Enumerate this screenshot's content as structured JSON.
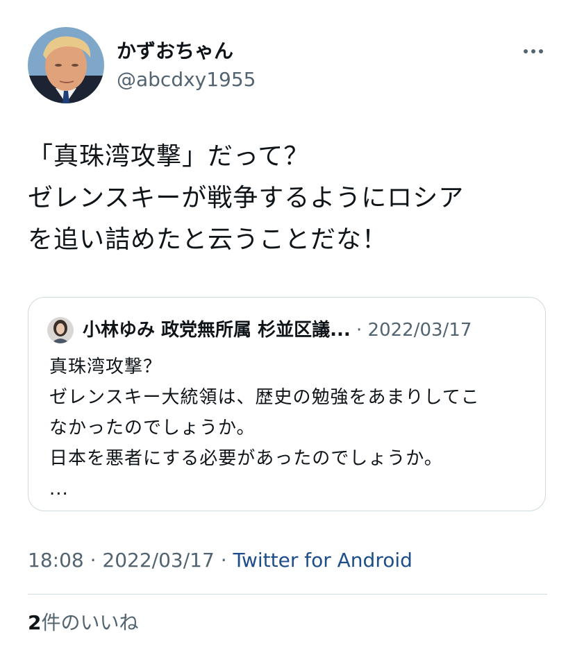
{
  "author": {
    "display_name": "かずおちゃん",
    "handle": "@abcdxy1955"
  },
  "tweet": {
    "lines": [
      "「真珠湾攻撃」だって？",
      "ゼレンスキーが戦争するようにロシア",
      "を追い詰めたと云うことだな！"
    ]
  },
  "quote": {
    "author_name": "小林ゆみ 政党無所属 杉並区議...",
    "separator": "·",
    "date": "2022/03/17",
    "lines": [
      "真珠湾攻撃？",
      "ゼレンスキー大統領は、歴史の勉強をあまりしてこ",
      "なかったのでしょうか。",
      "日本を悪者にする必要があったのでしょうか。",
      "..."
    ]
  },
  "meta": {
    "time": "18:08",
    "sep1": " · ",
    "date": "2022/03/17",
    "sep2": " · ",
    "source": "Twitter for Android"
  },
  "likes": {
    "count": "2",
    "label": "件のいいね"
  },
  "icons": {
    "more": "more-horizontal-icon"
  },
  "colors": {
    "text": "#0f1419",
    "secondary": "#536471",
    "border": "#cfd9de",
    "source_link": "#1d4e89"
  }
}
